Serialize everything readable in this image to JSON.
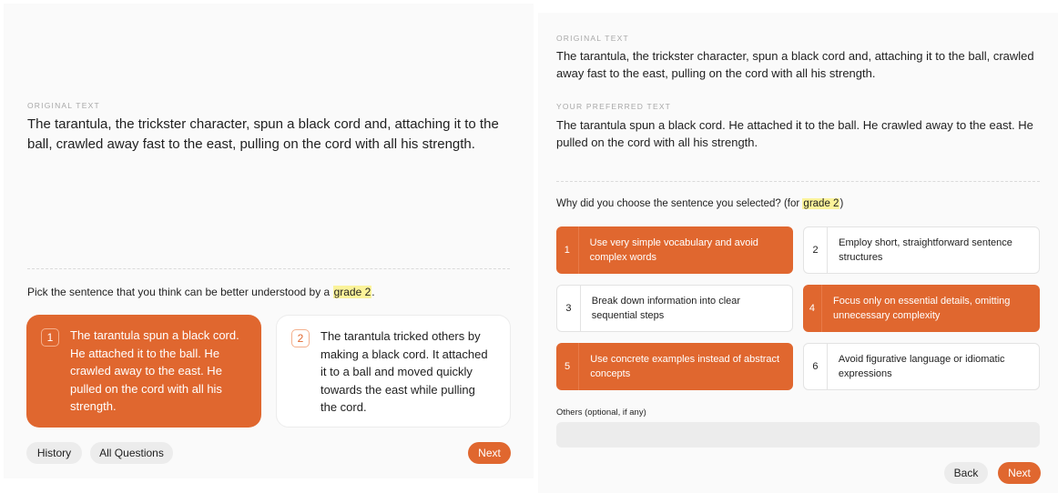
{
  "left": {
    "original_caption": "ORIGINAL TEXT",
    "original_text": "The tarantula, the trickster character, spun a black cord and, attaching it to the ball, crawled away fast to the east, pulling on the cord with all his strength.",
    "prompt_prefix": "Pick the sentence that you think can be better understood by a ",
    "prompt_grade": "grade 2",
    "prompt_suffix": ".",
    "choices": [
      {
        "number": "1",
        "text": "The tarantula spun a black cord. He attached it to the ball. He crawled away to the east. He pulled on the cord with all his strength.",
        "selected": true
      },
      {
        "number": "2",
        "text": "The tarantula tricked others by making a black cord. It attached it to a ball and moved quickly towards the east while pulling the cord.",
        "selected": false
      }
    ],
    "buttons": {
      "history": "History",
      "all_questions": "All Questions",
      "next": "Next"
    }
  },
  "right": {
    "original_caption": "ORIGINAL TEXT",
    "original_text": "The tarantula, the trickster character, spun a black cord and, attaching it to the ball, crawled away fast to the east, pulling on the cord with all his strength.",
    "preferred_caption": "YOUR PREFERRED TEXT",
    "preferred_text": "The tarantula spun a black cord. He attached it to the ball. He crawled away to the east. He pulled on the cord with all his strength.",
    "question_prefix": "Why did you choose the sentence you selected? (for ",
    "question_grade": "grade 2",
    "question_suffix": ")",
    "reasons": [
      {
        "number": "1",
        "text": "Use very simple vocabulary and avoid complex words",
        "selected": true
      },
      {
        "number": "2",
        "text": "Employ short, straightforward sentence structures",
        "selected": false
      },
      {
        "number": "3",
        "text": "Break down information into clear sequential steps",
        "selected": false
      },
      {
        "number": "4",
        "text": "Focus only on essential details, omitting unnecessary complexity",
        "selected": true
      },
      {
        "number": "5",
        "text": "Use concrete examples instead of abstract concepts",
        "selected": true
      },
      {
        "number": "6",
        "text": "Avoid figurative language or idiomatic expressions",
        "selected": false
      }
    ],
    "others_label": "Others (optional, if any)",
    "others_value": "",
    "buttons": {
      "back": "Back",
      "next": "Next"
    }
  },
  "colors": {
    "accent": "#e0672f",
    "highlight": "#fbf39a",
    "panel_bg": "#fafafa",
    "button_gray": "#ececec"
  }
}
